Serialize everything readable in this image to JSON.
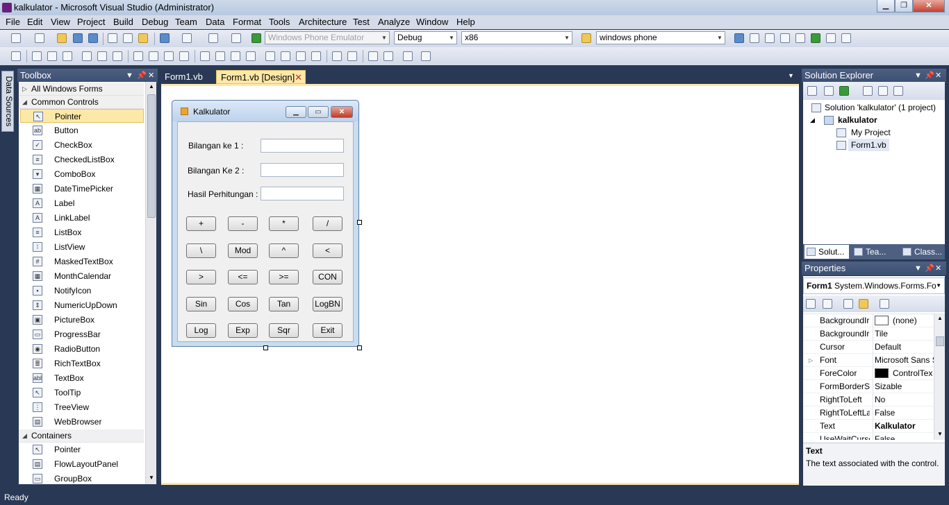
{
  "window": {
    "title": "kalkulator - Microsoft Visual Studio (Administrator)",
    "minimize": "▁",
    "maximize": "❐",
    "close": "✕"
  },
  "menu": [
    "File",
    "Edit",
    "View",
    "Project",
    "Build",
    "Debug",
    "Team",
    "Data",
    "Format",
    "Tools",
    "Architecture",
    "Test",
    "Analyze",
    "Window",
    "Help"
  ],
  "toolbar": {
    "target_device": "Windows Phone Emulator",
    "configuration": "Debug",
    "platform": "x86",
    "find_text": "windows phone"
  },
  "left_strip": {
    "data_sources": "Data Sources"
  },
  "toolbox": {
    "title": "Toolbox",
    "categories": [
      {
        "name": "All Windows Forms",
        "expanded": false
      },
      {
        "name": "Common Controls",
        "expanded": true
      },
      {
        "name": "Containers",
        "expanded": true
      }
    ],
    "common_controls": [
      {
        "label": "Pointer",
        "icon": "pointer-icon",
        "glyph": "↖",
        "selected": true
      },
      {
        "label": "Button",
        "icon": "button-icon",
        "glyph": "ab"
      },
      {
        "label": "CheckBox",
        "icon": "checkbox-icon",
        "glyph": "✓"
      },
      {
        "label": "CheckedListBox",
        "icon": "checkedlistbox-icon",
        "glyph": "≡"
      },
      {
        "label": "ComboBox",
        "icon": "combobox-icon",
        "glyph": "▾"
      },
      {
        "label": "DateTimePicker",
        "icon": "datetimepicker-icon",
        "glyph": "▦"
      },
      {
        "label": "Label",
        "icon": "label-icon",
        "glyph": "A"
      },
      {
        "label": "LinkLabel",
        "icon": "linklabel-icon",
        "glyph": "A"
      },
      {
        "label": "ListBox",
        "icon": "listbox-icon",
        "glyph": "≡"
      },
      {
        "label": "ListView",
        "icon": "listview-icon",
        "glyph": "⁞"
      },
      {
        "label": "MaskedTextBox",
        "icon": "maskedtextbox-icon",
        "glyph": "#"
      },
      {
        "label": "MonthCalendar",
        "icon": "monthcalendar-icon",
        "glyph": "▦"
      },
      {
        "label": "NotifyIcon",
        "icon": "notifyicon-icon",
        "glyph": "▪"
      },
      {
        "label": "NumericUpDown",
        "icon": "numericupdown-icon",
        "glyph": "⇕"
      },
      {
        "label": "PictureBox",
        "icon": "picturebox-icon",
        "glyph": "▣"
      },
      {
        "label": "ProgressBar",
        "icon": "progressbar-icon",
        "glyph": "▭"
      },
      {
        "label": "RadioButton",
        "icon": "radiobutton-icon",
        "glyph": "◉"
      },
      {
        "label": "RichTextBox",
        "icon": "richtextbox-icon",
        "glyph": "≣"
      },
      {
        "label": "TextBox",
        "icon": "textbox-icon",
        "glyph": "abl"
      },
      {
        "label": "ToolTip",
        "icon": "tooltip-icon",
        "glyph": "↖"
      },
      {
        "label": "TreeView",
        "icon": "treeview-icon",
        "glyph": "⋮"
      },
      {
        "label": "WebBrowser",
        "icon": "webbrowser-icon",
        "glyph": "▤"
      }
    ],
    "containers": [
      {
        "label": "Pointer",
        "icon": "pointer-icon",
        "glyph": "↖"
      },
      {
        "label": "FlowLayoutPanel",
        "icon": "flowlayoutpanel-icon",
        "glyph": "▤"
      },
      {
        "label": "GroupBox",
        "icon": "groupbox-icon",
        "glyph": "▭"
      }
    ]
  },
  "tabs": [
    {
      "label": "Form1.vb",
      "active": false
    },
    {
      "label": "Form1.vb [Design]",
      "active": true
    }
  ],
  "form": {
    "title": "Kalkulator",
    "labels": [
      "Bilangan ke 1 :",
      "Bilangan Ke 2 :",
      "Hasil Perhitungan :"
    ],
    "textbox_values": [
      "",
      "",
      ""
    ],
    "button_rows": [
      [
        "+",
        "-",
        "*",
        "/"
      ],
      [
        "\\",
        "Mod",
        "^",
        "<"
      ],
      [
        ">",
        "<=",
        ">=",
        "CON"
      ],
      [
        "Sin",
        "Cos",
        "Tan",
        "LogBN"
      ],
      [
        "Log",
        "Exp",
        "Sqr",
        "Exit"
      ]
    ]
  },
  "solution_explorer": {
    "title": "Solution Explorer",
    "tree": [
      {
        "label": "Solution 'kalkulator' (1 project)",
        "bold": false,
        "level": 0
      },
      {
        "label": "kalkulator",
        "bold": true,
        "level": 1
      },
      {
        "label": "My Project",
        "bold": false,
        "level": 2
      },
      {
        "label": "Form1.vb",
        "bold": false,
        "level": 2
      }
    ],
    "bottom_tabs": [
      "Solut...",
      "Tea...",
      "Class..."
    ]
  },
  "properties": {
    "title": "Properties",
    "object_name": "Form1",
    "object_type": "System.Windows.Forms.Fo",
    "rows": [
      {
        "name": "BackgroundIr",
        "value": "(none)",
        "swatch": "#ffffff"
      },
      {
        "name": "BackgroundIr",
        "value": "Tile"
      },
      {
        "name": "Cursor",
        "value": "Default"
      },
      {
        "name": "Font",
        "value": "Microsoft Sans S",
        "expandable": true
      },
      {
        "name": "ForeColor",
        "value": "ControlTex",
        "swatch": "#000000"
      },
      {
        "name": "FormBorderSt",
        "value": "Sizable"
      },
      {
        "name": "RightToLeft",
        "value": "No"
      },
      {
        "name": "RightToLeftLa",
        "value": "False"
      },
      {
        "name": "Text",
        "value": "Kalkulator",
        "bold": true
      },
      {
        "name": "UseWaitCursc",
        "value": "False"
      }
    ],
    "description_title": "Text",
    "description_text": "The text associated with the control."
  },
  "status": {
    "text": "Ready"
  },
  "colors": {
    "chrome": "#293955",
    "selection": "#fde9a7",
    "active_tab": "#ffe8a6"
  }
}
